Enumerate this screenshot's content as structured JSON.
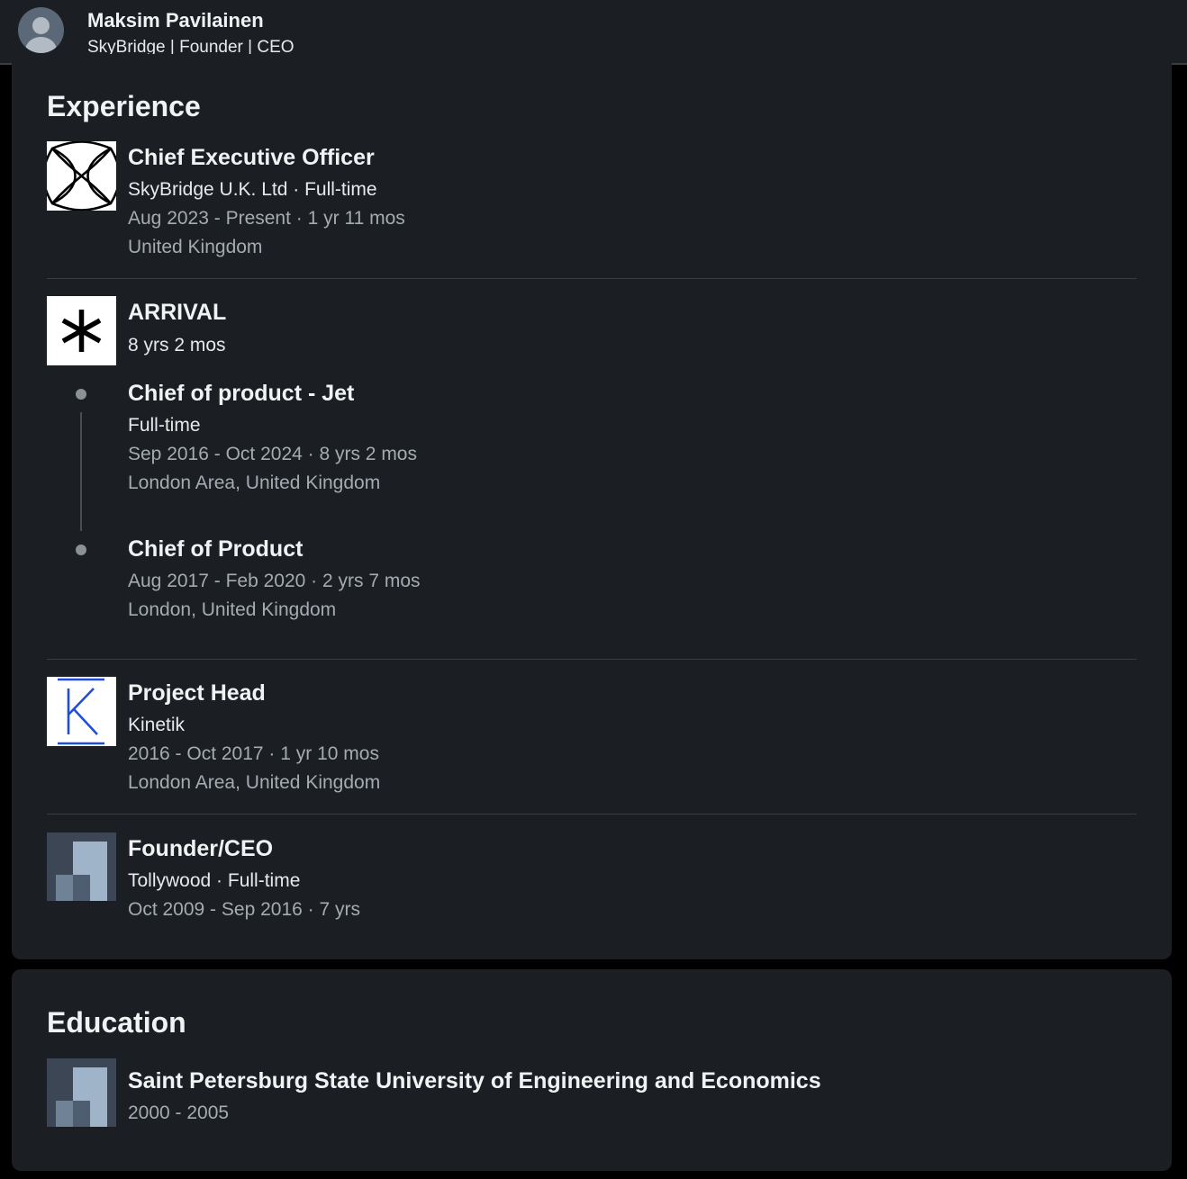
{
  "profile": {
    "name": "Maksim Pavilainen",
    "headline": "SkyBridge | Founder | CEO"
  },
  "experience": {
    "title": "Experience",
    "skybridge": {
      "title": "Chief Executive Officer",
      "company": "SkyBridge U.K. Ltd · Full-time",
      "dates": "Aug 2023 - Present · 1 yr 11 mos",
      "location": "United Kingdom",
      "logo_icon": "skybridge-lissajous-logo"
    },
    "arrival": {
      "company": "ARRIVAL",
      "duration": "8 yrs 2 mos",
      "logo_icon": "asterisk-logo",
      "roles": [
        {
          "title": "Chief of product - Jet",
          "type": "Full-time",
          "dates": "Sep 2016 - Oct 2024 · 8 yrs 2 mos",
          "location": "London Area, United Kingdom"
        },
        {
          "title": "Chief of Product",
          "dates": "Aug 2017 - Feb 2020 · 2 yrs 7 mos",
          "location": "London, United Kingdom"
        }
      ]
    },
    "kinetik": {
      "title": "Project Head",
      "company": "Kinetik",
      "dates": "2016 - Oct 2017 · 1 yr 10 mos",
      "location": "London Area, United Kingdom",
      "logo_icon": "k-letter-logo",
      "logo_color": "#1f4fd8"
    },
    "tollywood": {
      "title": "Founder/CEO",
      "company": "Tollywood · Full-time",
      "dates": "Oct 2009 - Sep 2016 · 7 yrs",
      "logo_icon": "building-placeholder-logo"
    }
  },
  "education": {
    "title": "Education",
    "school": "Saint Petersburg State University of Engineering and Economics",
    "years": "2000 - 2005",
    "logo_icon": "building-placeholder-logo"
  }
}
